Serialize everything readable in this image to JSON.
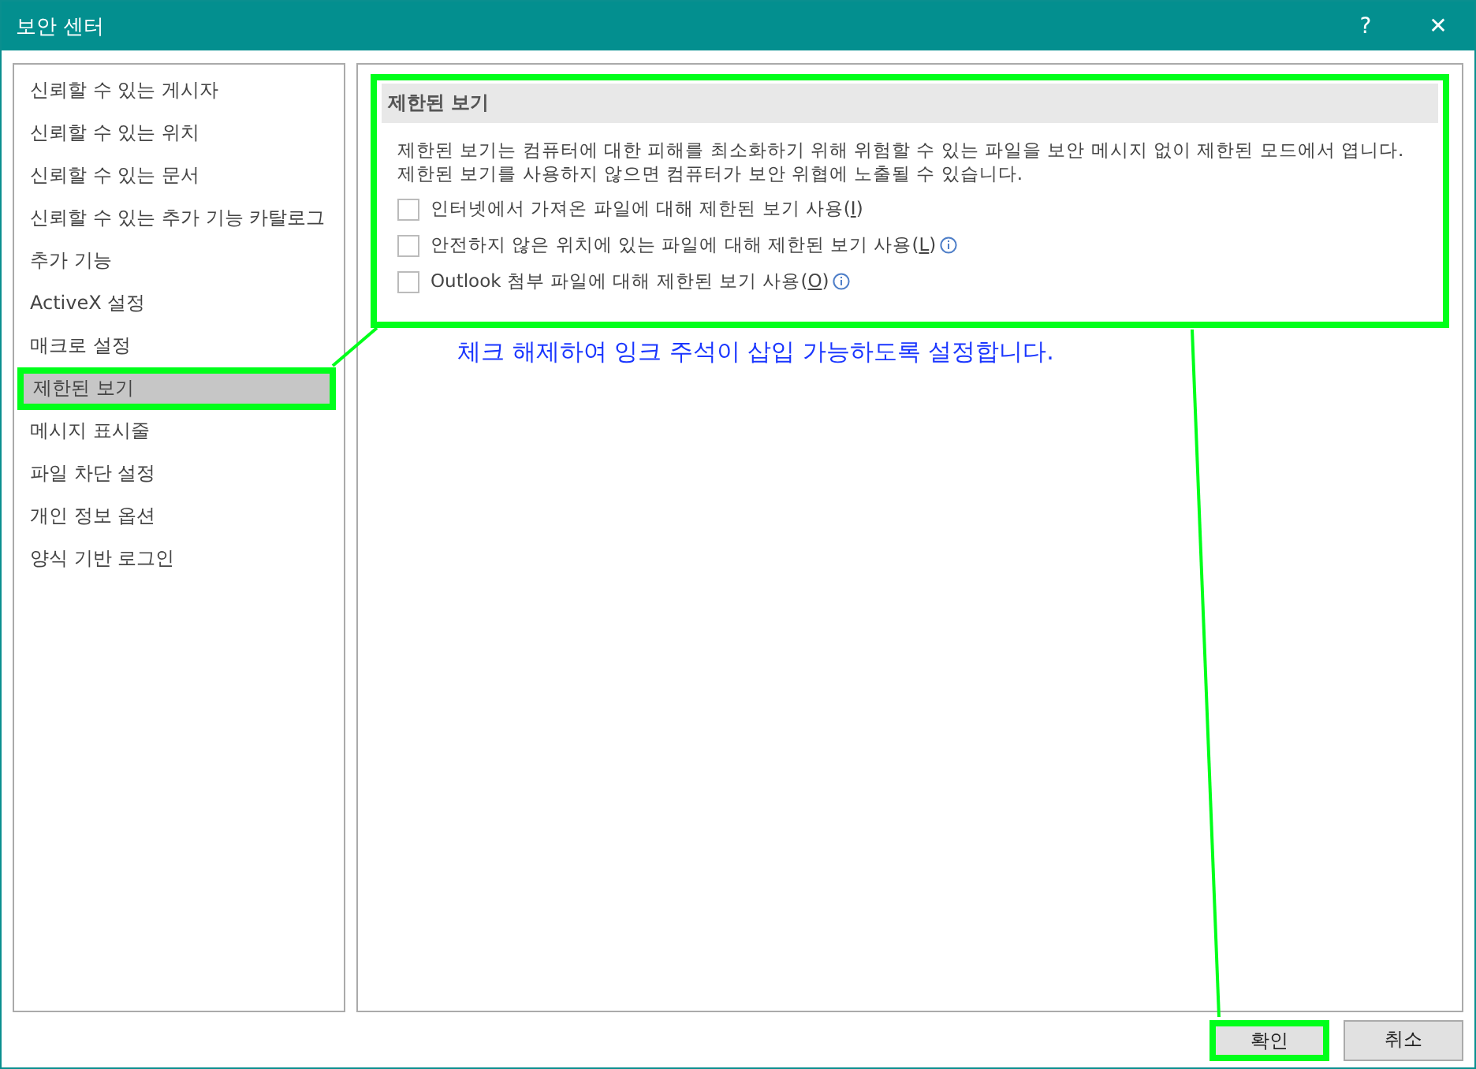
{
  "window": {
    "title": "보안 센터",
    "help": "?",
    "close": "✕"
  },
  "sidebar": {
    "items": [
      {
        "label": "신뢰할 수 있는 게시자",
        "selected": false,
        "highlighted": false
      },
      {
        "label": "신뢰할 수 있는 위치",
        "selected": false,
        "highlighted": false
      },
      {
        "label": "신뢰할 수 있는 문서",
        "selected": false,
        "highlighted": false
      },
      {
        "label": "신뢰할 수 있는 추가 기능 카탈로그",
        "selected": false,
        "highlighted": false
      },
      {
        "label": "추가 기능",
        "selected": false,
        "highlighted": false
      },
      {
        "label": "ActiveX 설정",
        "selected": false,
        "highlighted": false
      },
      {
        "label": "매크로 설정",
        "selected": false,
        "highlighted": false
      },
      {
        "label": "제한된 보기",
        "selected": true,
        "highlighted": true
      },
      {
        "label": "메시지 표시줄",
        "selected": false,
        "highlighted": false
      },
      {
        "label": "파일 차단 설정",
        "selected": false,
        "highlighted": false
      },
      {
        "label": "개인 정보 옵션",
        "selected": false,
        "highlighted": false
      },
      {
        "label": "양식 기반 로그인",
        "selected": false,
        "highlighted": false
      }
    ]
  },
  "section": {
    "title": "제한된 보기",
    "highlighted": true,
    "description": [
      "제한된 보기는 컴퓨터에 대한 피해를 최소화하기 위해 위험할 수 있는 파일을 보안 메시지 없이 제한된 모드에서 엽니다.",
      "제한된 보기를 사용하지 않으면 컴퓨터가 보안 위협에 노출될 수 있습니다."
    ],
    "options": [
      {
        "before": "인터넷에서 가져온 파일에 대해 제한된 보기 사용(",
        "key": "I",
        "after": ")",
        "checked": false,
        "info": false
      },
      {
        "before": "안전하지 않은 위치에 있는 파일에 대해 제한된 보기 사용(",
        "key": "L",
        "after": ")",
        "checked": false,
        "info": true
      },
      {
        "before": "Outlook 첨부 파일에 대해 제한된 보기 사용(",
        "key": "O",
        "after": ")",
        "checked": false,
        "info": true
      }
    ]
  },
  "callout": "체크 해제하여 잉크 주석이 삽입 가능하도록 설정합니다.",
  "buttons": [
    {
      "label": "확인",
      "highlighted": true
    },
    {
      "label": "취소",
      "highlighted": false
    }
  ]
}
